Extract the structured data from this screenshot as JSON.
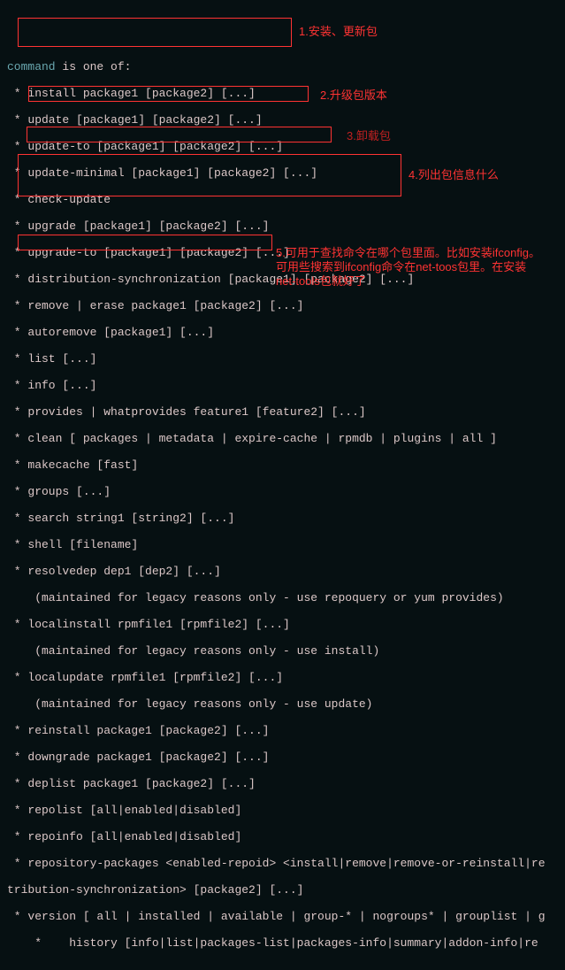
{
  "header": "command is one of:",
  "header_kw": "command",
  "header_rest": " is one of:",
  "lines": [
    " * install package1 [package2] [...]",
    " * update [package1] [package2] [...]",
    " * update-to [package1] [package2] [...]",
    " * update-minimal [package1] [package2] [...]",
    " * check-update",
    " * upgrade [package1] [package2] [...]",
    " * upgrade-to [package1] [package2] [...]",
    " * distribution-synchronization [package1] [package2] [...]",
    " * remove | erase package1 [package2] [...]",
    " * autoremove [package1] [...]",
    " * list [...]",
    " * info [...]",
    " * provides | whatprovides feature1 [feature2] [...]",
    " * clean [ packages | metadata | expire-cache | rpmdb | plugins | all ]",
    " * makecache [fast]",
    " * groups [...]",
    " * search string1 [string2] [...]",
    " * shell [filename]",
    " * resolvedep dep1 [dep2] [...]",
    "    (maintained for legacy reasons only - use repoquery or yum provides)",
    " * localinstall rpmfile1 [rpmfile2] [...]",
    "    (maintained for legacy reasons only - use install)",
    " * localupdate rpmfile1 [rpmfile2] [...]",
    "    (maintained for legacy reasons only - use update)",
    " * reinstall package1 [package2] [...]",
    " * downgrade package1 [package2] [...]",
    " * deplist package1 [package2] [...]",
    " * repolist [all|enabled|disabled]",
    " * repoinfo [all|enabled|disabled]",
    " * repository-packages <enabled-repoid> <install|remove|remove-or-reinstall|re",
    "tribution-synchronization> [package2] [...]",
    " * version [ all | installed | available | group-* | nogroups* | grouplist | g",
    "    *    history [info|list|packages-list|packages-info|summary|addon-info|re"
  ],
  "annotations": {
    "a1": "1.安装、更新包",
    "a2": "2.升级包版本",
    "a3": "3.卸载包",
    "a4": "4.列出包信息什么",
    "a5": "5.可用于查找命令在哪个包里面。比如安装ifconfig。可用些搜索到ifconfig命令在net-toos包里。在安装net-tools包就好了"
  }
}
